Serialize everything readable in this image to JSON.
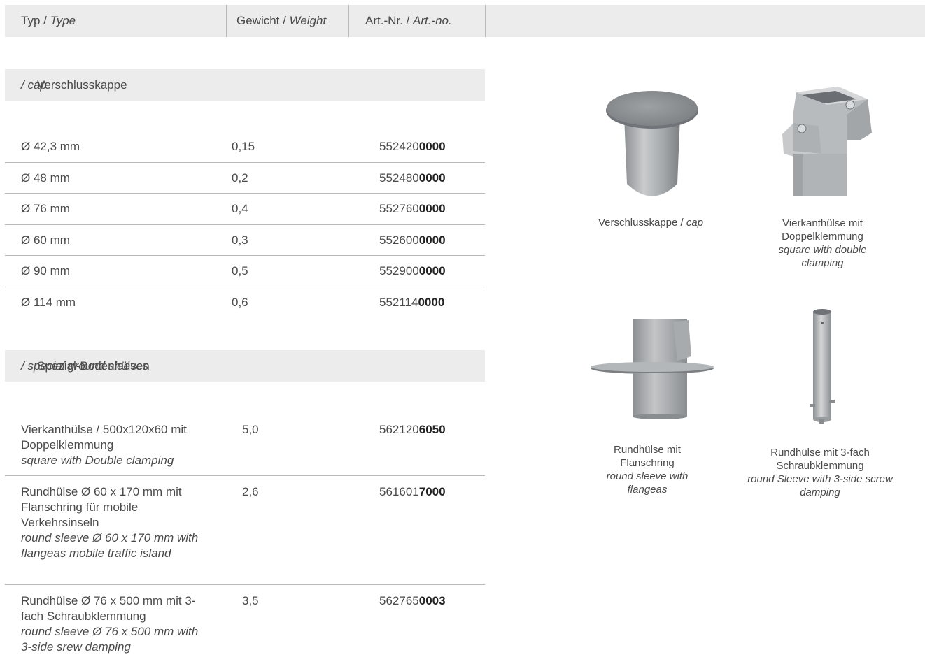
{
  "header": {
    "type_de": "Typ / ",
    "type_en": "Type",
    "weight_de": "Gewicht / ",
    "weight_en": "Weight",
    "artno_de": "Art.-Nr. / ",
    "artno_en": "Art.-no."
  },
  "section1": {
    "title_de": "Verschlusskappe ",
    "title_en": "/ cap"
  },
  "caps": [
    {
      "type": "Ø 42,3 mm",
      "weight": "0,15",
      "art_prefix": "552420",
      "art_suffix": "0000"
    },
    {
      "type": "Ø 48 mm",
      "weight": "0,2",
      "art_prefix": "552480",
      "art_suffix": "0000"
    },
    {
      "type": "Ø 76 mm",
      "weight": "0,4",
      "art_prefix": "552760",
      "art_suffix": "0000"
    },
    {
      "type": "Ø 60 mm",
      "weight": "0,3",
      "art_prefix": "552600",
      "art_suffix": "0000"
    },
    {
      "type": "Ø 90 mm",
      "weight": "0,5",
      "art_prefix": "552900",
      "art_suffix": "0000"
    },
    {
      "type": "Ø 114 mm",
      "weight": "0,6",
      "art_prefix": "552114",
      "art_suffix": "0000"
    }
  ],
  "section2": {
    "title_de": "Spezial-Bodenhülsen ",
    "title_en": "/ special ground sleeves"
  },
  "sleeves": [
    {
      "type_de": "Vierkanthülse /  500x120x60 mit Doppelklemmung",
      "type_en": "square with Double clamping",
      "weight": "5,0",
      "art_prefix": "562120",
      "art_suffix": "6050"
    },
    {
      "type_de": "Rundhülse Ø 60 x 170 mm mit Flanschring für mobile Verkehrsinseln",
      "type_en": "round sleeve Ø 60 x 170 mm with flangeas mobile traffic island",
      "weight": "2,6",
      "art_prefix": "561601",
      "art_suffix": "7000"
    },
    {
      "type_de": "Rundhülse Ø 76 x 500 mm mit 3-fach Schraubklemmung",
      "type_en": "round sleeve Ø 76 x 500 mm with 3-side srew damping",
      "weight": "3,5",
      "art_prefix": "562765",
      "art_suffix": "0003"
    }
  ],
  "captions": {
    "cap_de": "Verschlusskappe / ",
    "cap_en": "cap",
    "square_de": "Vierkanthülse mit Doppelklemmung",
    "square_en": "square with double clamping",
    "flange_de": "Rundhülse mit Flanschring",
    "flange_en": "round sleeve with flangeas",
    "screw_de": "Rundhülse mit 3-fach Schraubklemmung",
    "screw_en": "round Sleeve with 3-side screw damping"
  },
  "colors": {
    "header_bg": "#ececec",
    "divider": "#b9b9b9",
    "text": "#4a4a4a"
  }
}
